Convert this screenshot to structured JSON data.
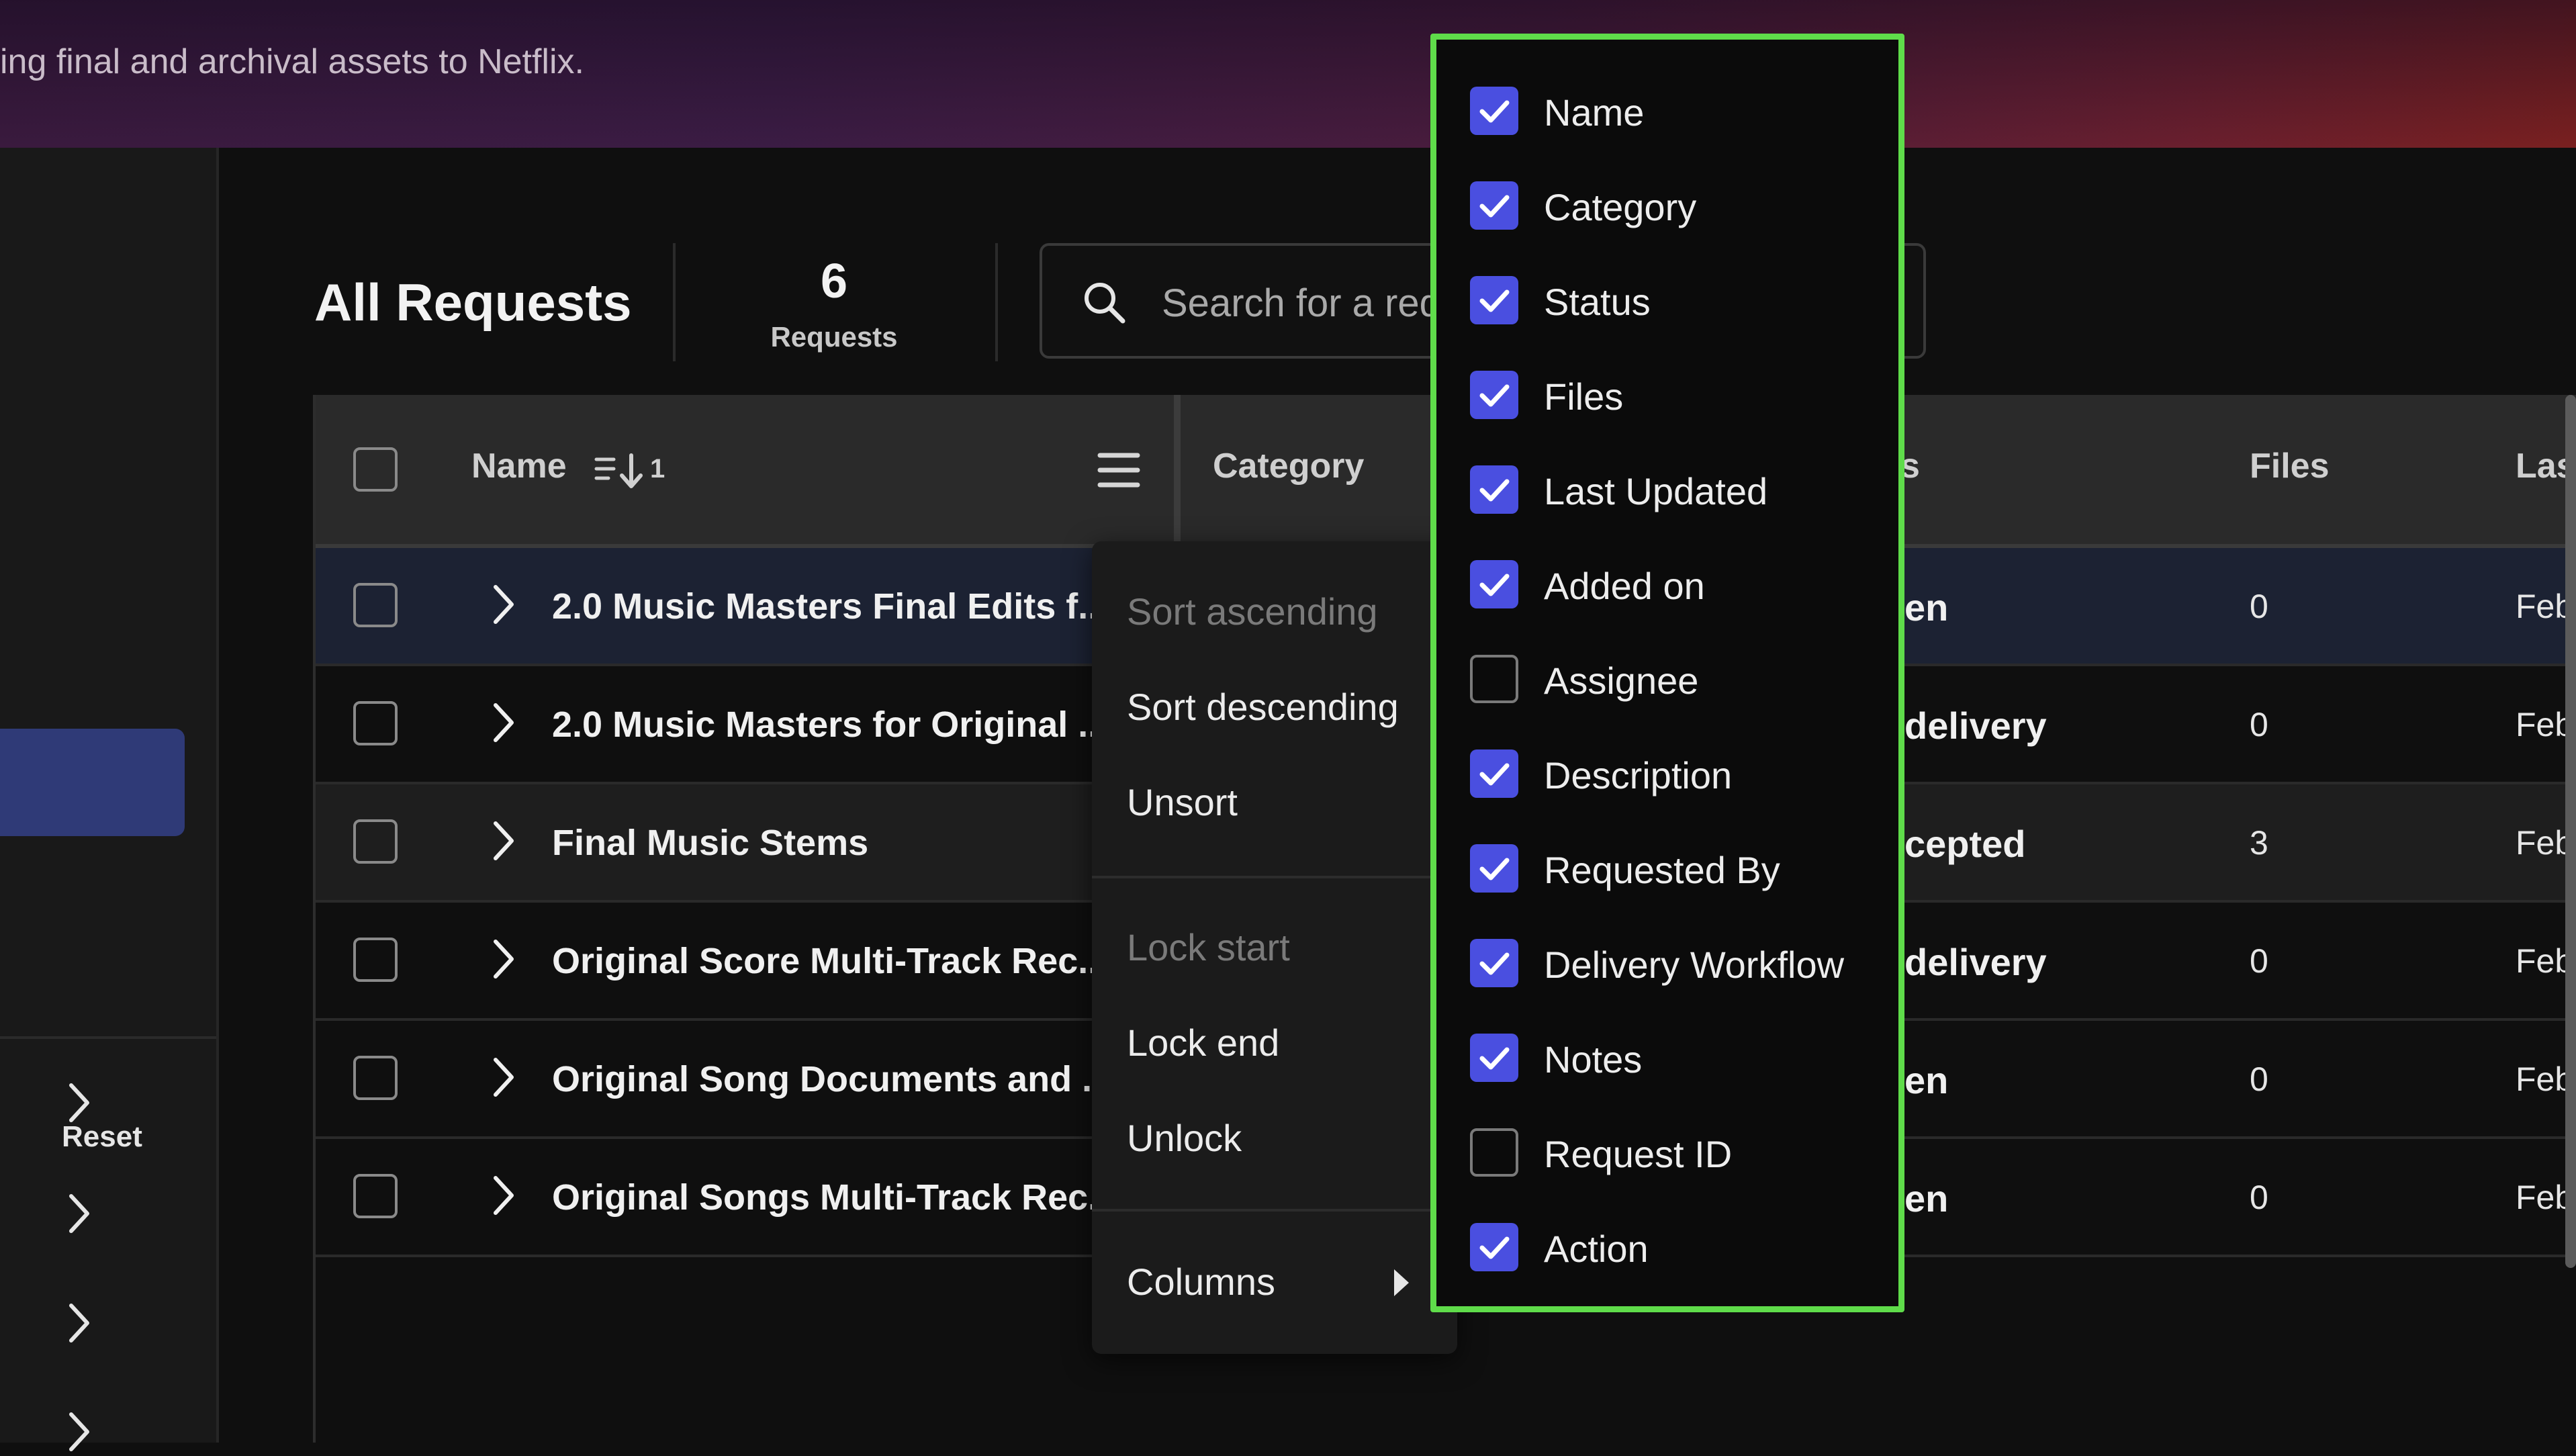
{
  "banner": {
    "text": "ing final and archival assets to Netflix."
  },
  "sidebar": {
    "reset_label": "Reset"
  },
  "header": {
    "title": "All Requests",
    "count": "6",
    "count_label": "Requests",
    "search_placeholder": "Search for a req"
  },
  "table": {
    "columns": {
      "name": "Name",
      "sort_rank": "1",
      "category": "Category",
      "status_partial": "s",
      "files": "Files",
      "last_partial": "Las"
    },
    "rows": [
      {
        "name": "2.0 Music Masters Final Edits f...",
        "status": "en",
        "files": "0",
        "last": "Feb"
      },
      {
        "name": "2.0 Music Masters for Original ...",
        "status": "delivery",
        "files": "0",
        "last": "Feb"
      },
      {
        "name": "Final Music Stems",
        "status": "cepted",
        "files": "3",
        "last": "Feb"
      },
      {
        "name": "Original Score Multi-Track Rec...",
        "status": "delivery",
        "files": "0",
        "last": "Feb"
      },
      {
        "name": "Original Song Documents and ...",
        "status": "en",
        "files": "0",
        "last": "Feb"
      },
      {
        "name": "Original Songs Multi-Track Rec...",
        "status": "en",
        "files": "0",
        "last": "Feb"
      }
    ]
  },
  "context_menu": {
    "sort_ascending": "Sort ascending",
    "sort_descending": "Sort descending",
    "unsort": "Unsort",
    "lock_start": "Lock start",
    "lock_end": "Lock end",
    "unlock": "Unlock",
    "columns": "Columns"
  },
  "column_chooser": {
    "options": [
      {
        "label": "Name",
        "checked": true
      },
      {
        "label": "Category",
        "checked": true
      },
      {
        "label": "Status",
        "checked": true
      },
      {
        "label": "Files",
        "checked": true
      },
      {
        "label": "Last Updated",
        "checked": true
      },
      {
        "label": "Added on",
        "checked": true
      },
      {
        "label": "Assignee",
        "checked": false
      },
      {
        "label": "Description",
        "checked": true
      },
      {
        "label": "Requested By",
        "checked": true
      },
      {
        "label": "Delivery Workflow",
        "checked": true
      },
      {
        "label": "Notes",
        "checked": true
      },
      {
        "label": "Request ID",
        "checked": false
      },
      {
        "label": "Action",
        "checked": true
      }
    ]
  },
  "colors": {
    "accent": "#4a4fe0",
    "highlight_border": "#5fdc4a",
    "sidebar_active": "#2f3a77",
    "selected_row": "#1c2233"
  },
  "icons": {
    "search": "search-icon",
    "menu": "hamburger-menu-icon",
    "sort": "sort-ascending-icon",
    "expand": "chevron-right-icon",
    "check": "checkmark-icon",
    "submenu": "caret-right-icon"
  }
}
